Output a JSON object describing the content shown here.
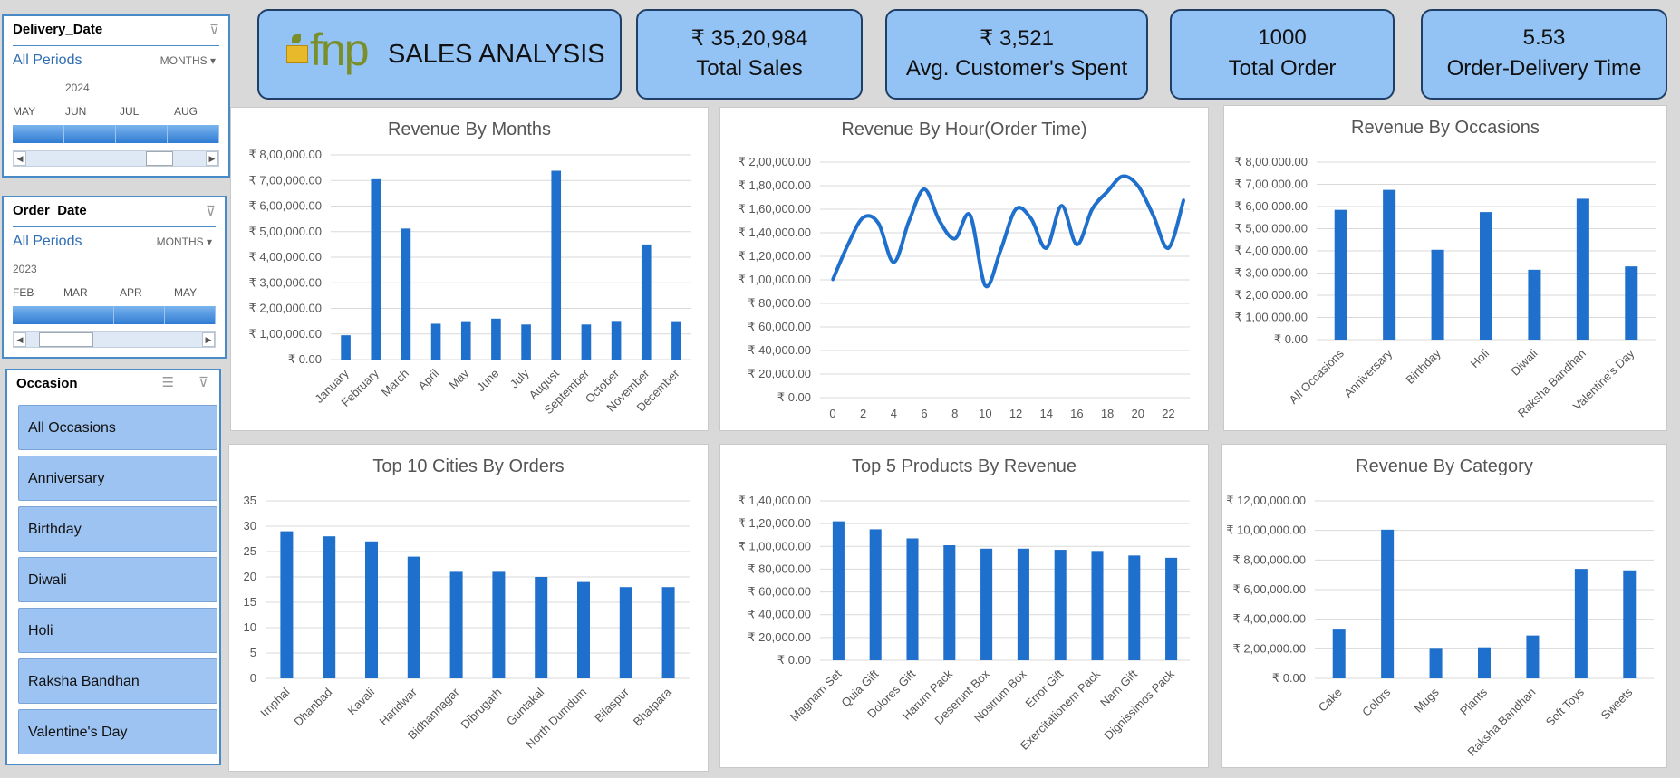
{
  "slicers": {
    "delivery": {
      "title": "Delivery_Date",
      "all_periods": "All Periods",
      "level": "MONTHS",
      "year": "2024",
      "months": [
        "MAY",
        "JUN",
        "JUL",
        "AUG"
      ]
    },
    "order": {
      "title": "Order_Date",
      "all_periods": "All Periods",
      "level": "MONTHS",
      "year": "2023",
      "months": [
        "FEB",
        "MAR",
        "APR",
        "MAY"
      ]
    },
    "occasion": {
      "title": "Occasion",
      "items": [
        "All Occasions",
        "Anniversary",
        "Birthday",
        "Diwali",
        "Holi",
        "Raksha Bandhan",
        "Valentine's Day"
      ]
    }
  },
  "header": {
    "logo_text": "fnp",
    "title": "SALES ANALYSIS"
  },
  "kpis": [
    {
      "value": "₹ 35,20,984",
      "label": "Total Sales"
    },
    {
      "value": "₹ 3,521",
      "label": "Avg. Customer's Spent"
    },
    {
      "value": "1000",
      "label": "Total Order"
    },
    {
      "value": "5.53",
      "label": "Order-Delivery Time"
    }
  ],
  "colors": {
    "bar": "#1f6fcc",
    "kpi_bg": "#93c2f5",
    "slicer_border": "#4a8ac7"
  },
  "chart_data": [
    {
      "id": "months",
      "type": "bar",
      "title": "Revenue By Months",
      "categories": [
        "January",
        "February",
        "March",
        "April",
        "May",
        "June",
        "July",
        "August",
        "September",
        "October",
        "November",
        "December"
      ],
      "values": [
        95000,
        705000,
        512000,
        140000,
        150000,
        160000,
        137000,
        738000,
        137000,
        151000,
        450000,
        150000
      ],
      "yticks": [
        "₹ 0.00",
        "₹ 1,00,000.00",
        "₹ 2,00,000.00",
        "₹ 3,00,000.00",
        "₹ 4,00,000.00",
        "₹ 5,00,000.00",
        "₹ 6,00,000.00",
        "₹ 7,00,000.00",
        "₹ 8,00,000.00"
      ],
      "ylim": [
        0,
        800000
      ]
    },
    {
      "id": "hours",
      "type": "line",
      "title": "Revenue By Hour(Order Time)",
      "x": [
        0,
        1,
        2,
        3,
        4,
        5,
        6,
        7,
        8,
        9,
        10,
        11,
        12,
        13,
        14,
        15,
        16,
        17,
        18,
        19,
        20,
        21,
        22,
        23
      ],
      "values": [
        100000,
        130000,
        153000,
        148000,
        115000,
        150000,
        177000,
        150000,
        135000,
        155000,
        95000,
        125000,
        160000,
        152000,
        127000,
        163000,
        130000,
        160000,
        175000,
        188000,
        180000,
        155000,
        127000,
        168000
      ],
      "xticks": [
        "0",
        "2",
        "4",
        "6",
        "8",
        "10",
        "12",
        "14",
        "16",
        "18",
        "20",
        "22"
      ],
      "yticks": [
        "₹ 0.00",
        "₹ 20,000.00",
        "₹ 40,000.00",
        "₹ 60,000.00",
        "₹ 80,000.00",
        "₹ 1,00,000.00",
        "₹ 1,20,000.00",
        "₹ 1,40,000.00",
        "₹ 1,60,000.00",
        "₹ 1,80,000.00",
        "₹ 2,00,000.00"
      ],
      "ylim": [
        0,
        200000
      ]
    },
    {
      "id": "occasions",
      "type": "bar",
      "title": "Revenue By Occasions",
      "categories": [
        "All Occasions",
        "Anniversary",
        "Birthday",
        "Holi",
        "Diwali",
        "Raksha Bandhan",
        "Valentine's Day"
      ],
      "values": [
        585000,
        675000,
        405000,
        575000,
        315000,
        635000,
        330000
      ],
      "yticks": [
        "₹ 0.00",
        "₹ 1,00,000.00",
        "₹ 2,00,000.00",
        "₹ 3,00,000.00",
        "₹ 4,00,000.00",
        "₹ 5,00,000.00",
        "₹ 6,00,000.00",
        "₹ 7,00,000.00",
        "₹ 8,00,000.00"
      ],
      "ylim": [
        0,
        800000
      ]
    },
    {
      "id": "cities",
      "type": "bar",
      "title": "Top 10 Cities By Orders",
      "categories": [
        "Imphal",
        "Dhanbad",
        "Kavali",
        "Haridwar",
        "Bidhannagar",
        "Dibrugarh",
        "Guntakal",
        "North Dumdum",
        "Bilaspur",
        "Bhatpara"
      ],
      "values": [
        29,
        28,
        27,
        24,
        21,
        21,
        20,
        19,
        18,
        18
      ],
      "yticks": [
        "0",
        "5",
        "10",
        "15",
        "20",
        "25",
        "30",
        "35"
      ],
      "ylim": [
        0,
        35
      ]
    },
    {
      "id": "products",
      "type": "bar",
      "title": "Top 5 Products By Revenue",
      "categories": [
        "Magnam Set",
        "Quia Gift",
        "Dolores Gift",
        "Harum Pack",
        "Deserunt Box",
        "Nostrum Box",
        "Error Gift",
        "Exercitationem Pack",
        "Nam Gift",
        "Dignissimos Pack"
      ],
      "values": [
        122000,
        115000,
        107000,
        101000,
        98000,
        98000,
        97000,
        96000,
        92000,
        90000
      ],
      "yticks": [
        "₹ 0.00",
        "₹ 20,000.00",
        "₹ 40,000.00",
        "₹ 60,000.00",
        "₹ 80,000.00",
        "₹ 1,00,000.00",
        "₹ 1,20,000.00",
        "₹ 1,40,000.00"
      ],
      "ylim": [
        0,
        140000
      ]
    },
    {
      "id": "category",
      "type": "bar",
      "title": "Revenue By Category",
      "categories": [
        "Cake",
        "Colors",
        "Mugs",
        "Plants",
        "Raksha Bandhan",
        "Soft Toys",
        "Sweets"
      ],
      "values": [
        330000,
        1005000,
        200000,
        210000,
        290000,
        740000,
        730000
      ],
      "yticks": [
        "₹ 0.00",
        "₹ 2,00,000.00",
        "₹ 4,00,000.00",
        "₹ 6,00,000.00",
        "₹ 8,00,000.00",
        "₹ 10,00,000.00",
        "₹ 12,00,000.00"
      ],
      "ylim": [
        0,
        1200000
      ]
    }
  ]
}
